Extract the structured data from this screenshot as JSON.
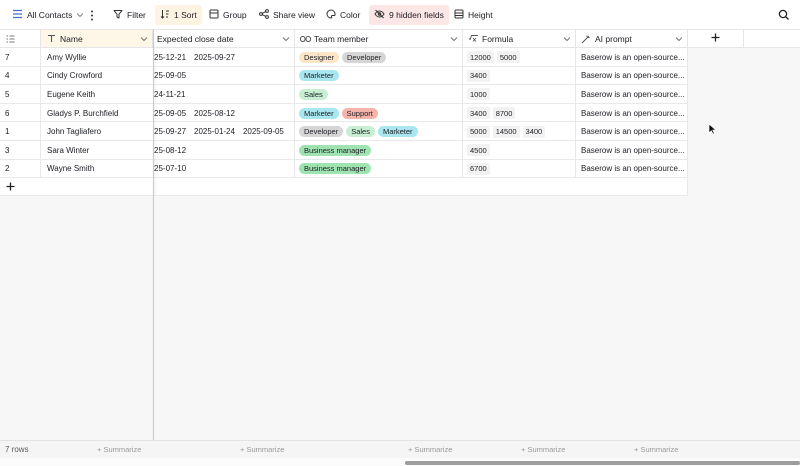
{
  "toolbar": {
    "view_label": "All Contacts",
    "filter_label": "Filter",
    "sort_label": "1 Sort",
    "group_label": "Group",
    "share_label": "Share view",
    "color_label": "Color",
    "hidden_label": "9 hidden fields",
    "height_label": "Height"
  },
  "columns": {
    "name": "Name",
    "close_date": "Expected close date",
    "team": "Team member",
    "formula": "Formula",
    "ai": "AI prompt"
  },
  "rows": [
    {
      "id": "7",
      "name": "Amy Wyllie",
      "dates": [
        "25-12-21",
        "2025-09-27"
      ],
      "team": [
        {
          "label": "Designer",
          "color": "#fde6c8"
        },
        {
          "label": "Developer",
          "color": "#d6d6d6"
        }
      ],
      "formula": [
        "12000",
        "5000"
      ],
      "ai": "Baserow is an open-source..."
    },
    {
      "id": "4",
      "name": "Cindy Crowford",
      "dates": [
        "25-09-05"
      ],
      "team": [
        {
          "label": "Marketer",
          "color": "#a8e6f0"
        }
      ],
      "formula": [
        "3400"
      ],
      "ai": "Baserow is an open-source..."
    },
    {
      "id": "5",
      "name": "Eugene Keith",
      "dates": [
        "24-11-21"
      ],
      "team": [
        {
          "label": "Sales",
          "color": "#c8efd3"
        }
      ],
      "formula": [
        "1000"
      ],
      "ai": "Baserow is an open-source..."
    },
    {
      "id": "6",
      "name": "Gladys P. Burchfield",
      "dates": [
        "25-09-05",
        "2025-08-12"
      ],
      "team": [
        {
          "label": "Marketer",
          "color": "#a8e6f0"
        },
        {
          "label": "Support",
          "color": "#f5b3aa"
        }
      ],
      "formula": [
        "3400",
        "8700"
      ],
      "ai": "Baserow is an open-source..."
    },
    {
      "id": "1",
      "name": "John Tagliafero",
      "dates": [
        "25-09-27",
        "2025-01-24",
        "2025-09-05"
      ],
      "team": [
        {
          "label": "Developer",
          "color": "#d6d6d6"
        },
        {
          "label": "Sales",
          "color": "#c8efd3"
        },
        {
          "label": "Marketer",
          "color": "#a8e6f0"
        }
      ],
      "formula": [
        "5000",
        "14500",
        "3400"
      ],
      "ai": "Baserow is an open-source..."
    },
    {
      "id": "3",
      "name": "Sara Winter",
      "dates": [
        "25-08-12"
      ],
      "team": [
        {
          "label": "Business manager",
          "color": "#9ee3b0"
        }
      ],
      "formula": [
        "4500"
      ],
      "ai": "Baserow is an open-source..."
    },
    {
      "id": "2",
      "name": "Wayne Smith",
      "dates": [
        "25-07-10"
      ],
      "team": [
        {
          "label": "Business manager",
          "color": "#9ee3b0"
        }
      ],
      "formula": [
        "6700"
      ],
      "ai": "Baserow is an open-source..."
    }
  ],
  "footer": {
    "rows_count": "7 rows",
    "summarize_label": "Summarize"
  }
}
